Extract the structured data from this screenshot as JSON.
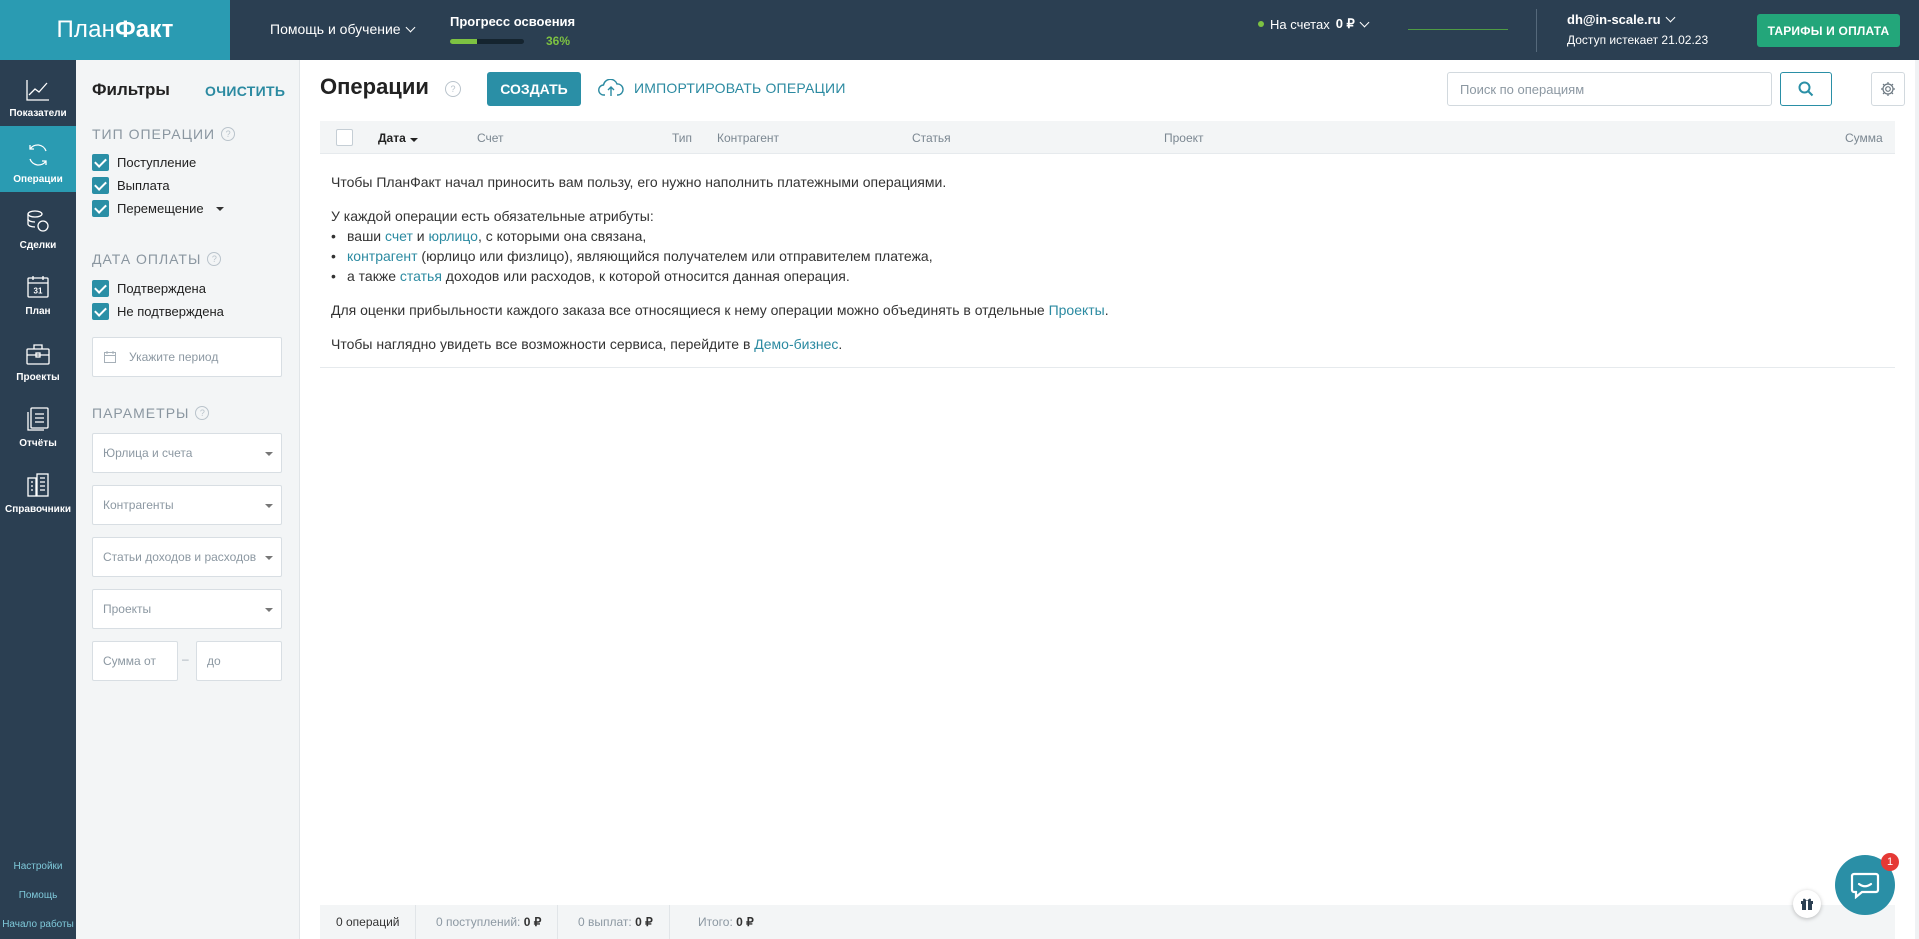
{
  "brand": {
    "logo_plain": "План",
    "logo_bold": "Факт"
  },
  "header": {
    "help_menu": "Помощь и обучение",
    "progress": {
      "title": "Прогресс освоения",
      "percent_label": "36%",
      "value": 0.36
    },
    "accounts": {
      "label": "На счетах",
      "amount": "0 ₽"
    },
    "user": {
      "email": "dh@in-scale.ru",
      "access": "Доступ истекает 21.02.23"
    },
    "tariff_button": "ТАРИФЫ И ОПЛАТА"
  },
  "nav": {
    "items": [
      {
        "label": "Показатели",
        "icon": "chart-line-icon"
      },
      {
        "label": "Операции",
        "icon": "refresh-icon"
      },
      {
        "label": "Сделки",
        "icon": "coins-icon"
      },
      {
        "label": "План",
        "icon": "calendar-icon",
        "icon_text": "31"
      },
      {
        "label": "Проекты",
        "icon": "briefcase-icon"
      },
      {
        "label": "Отчёты",
        "icon": "reports-icon"
      },
      {
        "label": "Справочники",
        "icon": "buildings-icon"
      }
    ],
    "bottom": [
      "Настройки",
      "Помощь",
      "Начало работы"
    ]
  },
  "filters": {
    "title": "Фильтры",
    "clear": "ОЧИСТИТЬ",
    "op_type": {
      "title": "ТИП ОПЕРАЦИИ",
      "items": [
        "Поступление",
        "Выплата",
        "Перемещение"
      ]
    },
    "pay_date": {
      "title": "ДАТА ОПЛАТЫ",
      "items": [
        "Подтверждена",
        "Не подтверждена"
      ],
      "period_placeholder": "Укажите период"
    },
    "params": {
      "title": "ПАРАМЕТРЫ",
      "selects": [
        "Юрлица и счета",
        "Контрагенты",
        "Статьи доходов и расходов",
        "Проекты"
      ],
      "sum_from": "Сумма от",
      "sum_to": "до",
      "dash": "–"
    }
  },
  "main": {
    "title": "Операции",
    "create": "СОЗДАТЬ",
    "import": "ИМПОРТИРОВАТЬ ОПЕРАЦИИ",
    "search_placeholder": "Поиск по операциям",
    "columns": [
      "Дата",
      "Счет",
      "Тип",
      "Контрагент",
      "Статья",
      "Проект",
      "Сумма"
    ],
    "empty": {
      "p1": "Чтобы ПланФакт начал приносить вам пользу, его нужно наполнить платежными операциями.",
      "p2": "У каждой операции есть обязательные атрибуты:",
      "li1_a": "ваши ",
      "li1_link1": "счет",
      "li1_b": " и ",
      "li1_link2": "юрлицо",
      "li1_c": ", с которыми она связана,",
      "li2_link": "контрагент",
      "li2_b": " (юрлицо или физлицо), являющийся получателем или отправителем платежа,",
      "li3_a": "а также ",
      "li3_link": "статья",
      "li3_b": " доходов или расходов, к которой относится данная операция.",
      "p3_a": "Для оценки прибыльности каждого заказа все относящиеся к нему операции можно объединять в отдельные ",
      "p3_link": "Проекты",
      "p3_b": ".",
      "p4_a": "Чтобы наглядно увидеть все возможности сервиса, перейдите в ",
      "p4_link": "Демо-бизнес",
      "p4_b": "."
    }
  },
  "footer": {
    "count": "0 операций",
    "incomes_label": "0 поступлений:",
    "incomes_value": "0 ₽",
    "payments_label": "0 выплат:",
    "payments_value": "0 ₽",
    "total_label": "Итого:",
    "total_value": "0 ₽"
  },
  "chat": {
    "badge": "1"
  },
  "colors": {
    "topbar": "#2b3f52",
    "accent": "#2a9bb2",
    "primary_button": "#2a8fa6",
    "tariff_button": "#23a67a",
    "progress": "#7dc242"
  }
}
